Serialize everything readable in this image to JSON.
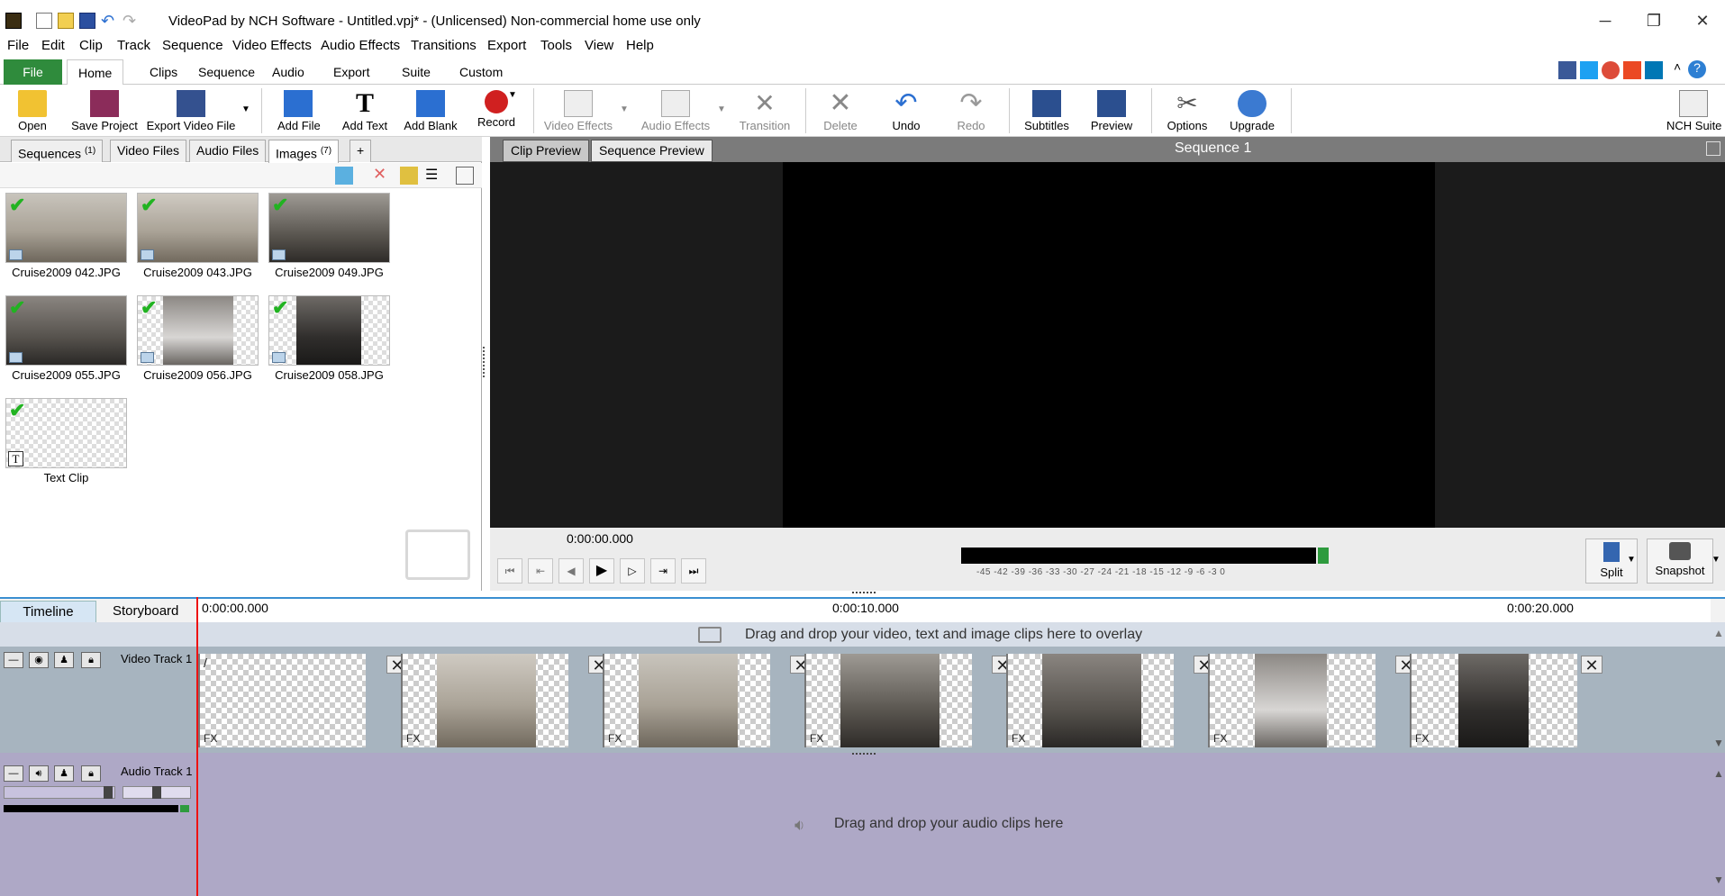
{
  "window": {
    "title": "VideoPad by NCH Software - Untitled.vpj* - (Unlicensed) Non-commercial home use only",
    "controls": {
      "minimize": "─",
      "restore": "❐",
      "close": "✕"
    }
  },
  "menu": [
    "File",
    "Edit",
    "Clip",
    "Track",
    "Sequence",
    "Video Effects",
    "Audio Effects",
    "Transitions",
    "Export",
    "Tools",
    "View",
    "Help"
  ],
  "ribbon_tabs": [
    "File",
    "Home",
    "Clips",
    "Sequence",
    "Audio",
    "Export",
    "Suite",
    "Custom"
  ],
  "toolbar": {
    "open": "Open",
    "save_project": "Save Project",
    "export_video": "Export Video File",
    "add_file": "Add File",
    "add_text": "Add Text",
    "add_blank": "Add Blank",
    "record": "Record",
    "video_effects": "Video Effects",
    "audio_effects": "Audio Effects",
    "transition": "Transition",
    "delete": "Delete",
    "undo": "Undo",
    "redo": "Redo",
    "subtitles": "Subtitles",
    "preview": "Preview",
    "options": "Options",
    "upgrade": "Upgrade",
    "nch_suite": "NCH Suite"
  },
  "bin": {
    "tabs": {
      "sequences": "Sequences",
      "sequences_count": "(1)",
      "video": "Video Files",
      "audio": "Audio Files",
      "images": "Images",
      "images_count": "(7)",
      "add": "+"
    },
    "items": [
      "Cruise2009 042.JPG",
      "Cruise2009 043.JPG",
      "Cruise2009 049.JPG",
      "Cruise2009 055.JPG",
      "Cruise2009 056.JPG",
      "Cruise2009 058.JPG",
      "Text Clip"
    ]
  },
  "preview": {
    "tabs": {
      "clip": "Clip Preview",
      "sequence": "Sequence Preview"
    },
    "sequence_name": "Sequence 1",
    "timecode": "0:00:00.000",
    "meter_scale": "-45  -42  -39  -36  -33  -30  -27  -24  -21  -18  -15  -12   -9   -6   -3    0",
    "split": "Split",
    "snapshot": "Snapshot"
  },
  "timeline": {
    "tabs": {
      "timeline": "Timeline",
      "storyboard": "Storyboard"
    },
    "ruler": [
      "0:00:00.000",
      "0:00:10.000",
      "0:00:20.000"
    ],
    "overlay_hint": "Drag and drop your video, text and image clips here to overlay",
    "video_track": "Video Track 1",
    "audio_track": "Audio Track 1",
    "audio_hint": "Drag and drop your audio clips here",
    "fx_label": "FX"
  }
}
